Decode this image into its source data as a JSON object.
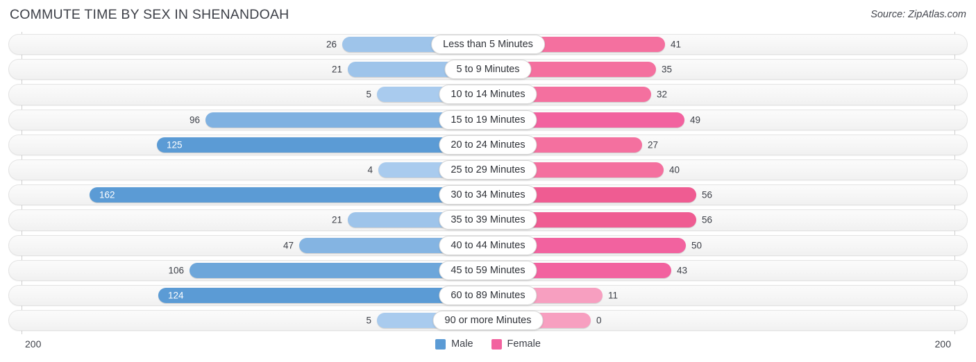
{
  "header": {
    "title": "COMMUTE TIME BY SEX IN SHENANDOAH",
    "source": "Source: ZipAtlas.com"
  },
  "axis": {
    "left_label": "200",
    "right_label": "200",
    "max": 200
  },
  "legend": [
    {
      "label": "Male",
      "color": "#5b9bd5"
    },
    {
      "label": "Female",
      "color": "#f2629f"
    }
  ],
  "colors": {
    "male_dark": "#5b9bd5",
    "male_light": "#9ec4ea",
    "female_dark": "#ef5c92",
    "female_mid": "#f4709f",
    "female_light": "#f79fc0",
    "track_bg": "#f6f6f6",
    "track_border": "#e3e3e3",
    "text": "#3c3f47"
  },
  "chart_data": {
    "type": "bar",
    "orientation": "horizontal-diverging",
    "title": "COMMUTE TIME BY SEX IN SHENANDOAH",
    "xlabel": "",
    "ylabel": "",
    "xlim": [
      200,
      200
    ],
    "grid": false,
    "legend_position": "bottom-center",
    "categories": [
      "Less than 5 Minutes",
      "5 to 9 Minutes",
      "10 to 14 Minutes",
      "15 to 19 Minutes",
      "20 to 24 Minutes",
      "25 to 29 Minutes",
      "30 to 34 Minutes",
      "35 to 39 Minutes",
      "40 to 44 Minutes",
      "45 to 59 Minutes",
      "60 to 89 Minutes",
      "90 or more Minutes"
    ],
    "series": [
      {
        "name": "Male",
        "values": [
          26,
          21,
          5,
          96,
          125,
          4,
          162,
          21,
          47,
          106,
          124,
          5
        ]
      },
      {
        "name": "Female",
        "values": [
          41,
          35,
          32,
          49,
          27,
          40,
          56,
          56,
          50,
          43,
          11,
          0
        ]
      }
    ]
  },
  "rows": [
    {
      "category": "Less than 5 Minutes",
      "male": "26",
      "female": "41",
      "male_width": 210,
      "female_width": 255,
      "male_color": "#9ec4ea",
      "female_color": "#f4709f",
      "male_inside": false,
      "female_inside": false
    },
    {
      "category": "5 to 9 Minutes",
      "male": "21",
      "female": "35",
      "male_width": 202,
      "female_width": 242,
      "male_color": "#9ec4ea",
      "female_color": "#f4709f",
      "male_inside": false,
      "female_inside": false
    },
    {
      "category": "10 to 14 Minutes",
      "male": "5",
      "female": "32",
      "male_width": 160,
      "female_width": 235,
      "male_color": "#a9cbee",
      "female_color": "#f4709f",
      "male_inside": false,
      "female_inside": false
    },
    {
      "category": "15 to 19 Minutes",
      "male": "96",
      "female": "49",
      "male_width": 407,
      "female_width": 283,
      "male_color": "#7fb1e1",
      "female_color": "#f2629f",
      "male_inside": false,
      "female_inside": false
    },
    {
      "category": "20 to 24 Minutes",
      "male": "125",
      "female": "27",
      "male_width": 477,
      "female_width": 222,
      "male_color": "#5b9bd5",
      "female_color": "#f4709f",
      "male_inside": true,
      "female_inside": false
    },
    {
      "category": "25 to 29 Minutes",
      "male": "4",
      "female": "40",
      "male_width": 158,
      "female_width": 253,
      "male_color": "#a9cbee",
      "female_color": "#f4709f",
      "male_inside": false,
      "female_inside": false
    },
    {
      "category": "30 to 34 Minutes",
      "male": "162",
      "female": "56",
      "male_width": 574,
      "female_width": 300,
      "male_color": "#5b9bd5",
      "female_color": "#ef5c92",
      "male_inside": true,
      "female_inside": false
    },
    {
      "category": "35 to 39 Minutes",
      "male": "21",
      "female": "56",
      "male_width": 202,
      "female_width": 300,
      "male_color": "#9ec4ea",
      "female_color": "#ef5c92",
      "male_inside": false,
      "female_inside": false
    },
    {
      "category": "40 to 44 Minutes",
      "male": "47",
      "female": "50",
      "male_width": 272,
      "female_width": 285,
      "male_color": "#84b4e2",
      "female_color": "#f2629f",
      "male_inside": false,
      "female_inside": false
    },
    {
      "category": "45 to 59 Minutes",
      "male": "106",
      "female": "43",
      "male_width": 430,
      "female_width": 264,
      "male_color": "#6da6da",
      "female_color": "#f2629f",
      "male_inside": false,
      "female_inside": false
    },
    {
      "category": "60 to 89 Minutes",
      "male": "124",
      "female": "11",
      "male_width": 475,
      "female_width": 165,
      "male_color": "#5b9bd5",
      "female_color": "#f79fc0",
      "male_inside": true,
      "female_inside": false
    },
    {
      "category": "90 or more Minutes",
      "male": "5",
      "female": "0",
      "male_width": 160,
      "female_width": 148,
      "male_color": "#a9cbee",
      "female_color": "#f79fc0",
      "male_inside": false,
      "female_inside": false
    }
  ]
}
